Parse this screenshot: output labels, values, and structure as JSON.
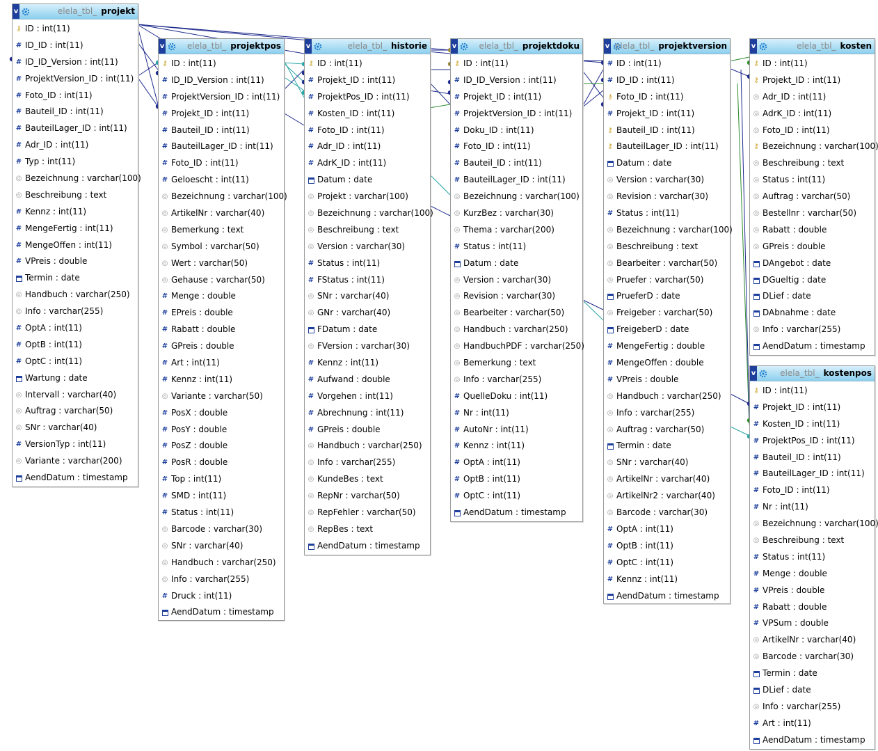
{
  "tables": [
    {
      "prefix": "elela_tbl_",
      "name": "projekt",
      "fields": [
        {
          "label": "ID : int(11)",
          "icon": "key-icon"
        },
        {
          "label": "ID_ID : int(11)",
          "icon": "number-icon"
        },
        {
          "label": "ID_ID_Version : int(11)",
          "icon": "number-icon"
        },
        {
          "label": "ProjektVersion_ID : int(11)",
          "icon": "number-icon"
        },
        {
          "label": "Foto_ID : int(11)",
          "icon": "number-icon"
        },
        {
          "label": "Bauteil_ID : int(11)",
          "icon": "number-icon"
        },
        {
          "label": "BauteilLager_ID : int(11)",
          "icon": "number-icon"
        },
        {
          "label": "Adr_ID : int(11)",
          "icon": "number-icon"
        },
        {
          "label": "Typ : int(11)",
          "icon": "number-icon"
        },
        {
          "label": "Bezeichnung : varchar(100)",
          "icon": "text-icon"
        },
        {
          "label": "Beschreibung : text",
          "icon": "text-icon"
        },
        {
          "label": "Kennz : int(11)",
          "icon": "number-icon"
        },
        {
          "label": "MengeFertig : int(11)",
          "icon": "number-icon"
        },
        {
          "label": "MengeOffen : int(11)",
          "icon": "number-icon"
        },
        {
          "label": "VPreis : double",
          "icon": "number-icon"
        },
        {
          "label": "Termin : date",
          "icon": "date-icon"
        },
        {
          "label": "Handbuch : varchar(250)",
          "icon": "text-icon"
        },
        {
          "label": "Info : varchar(255)",
          "icon": "text-icon"
        },
        {
          "label": "OptA : int(11)",
          "icon": "number-icon"
        },
        {
          "label": "OptB : int(11)",
          "icon": "number-icon"
        },
        {
          "label": "OptC : int(11)",
          "icon": "number-icon"
        },
        {
          "label": "Wartung : date",
          "icon": "date-icon"
        },
        {
          "label": "Intervall : varchar(40)",
          "icon": "text-icon"
        },
        {
          "label": "Auftrag : varchar(50)",
          "icon": "text-icon"
        },
        {
          "label": "SNr : varchar(40)",
          "icon": "text-icon"
        },
        {
          "label": "VersionTyp : int(11)",
          "icon": "number-icon"
        },
        {
          "label": "Variante : varchar(200)",
          "icon": "text-icon"
        },
        {
          "label": "AendDatum : timestamp",
          "icon": "date-icon"
        }
      ]
    },
    {
      "prefix": "elela_tbl_",
      "name": "projektpos",
      "fields": [
        {
          "label": "ID : int(11)",
          "icon": "key-icon"
        },
        {
          "label": "ID_ID_Version : int(11)",
          "icon": "number-icon"
        },
        {
          "label": "ProjektVersion_ID : int(11)",
          "icon": "number-icon"
        },
        {
          "label": "Projekt_ID : int(11)",
          "icon": "number-icon"
        },
        {
          "label": "Bauteil_ID : int(11)",
          "icon": "number-icon"
        },
        {
          "label": "BauteilLager_ID : int(11)",
          "icon": "number-icon"
        },
        {
          "label": "Foto_ID : int(11)",
          "icon": "number-icon"
        },
        {
          "label": "Geloescht : int(11)",
          "icon": "number-icon"
        },
        {
          "label": "Bezeichnung : varchar(100)",
          "icon": "text-icon"
        },
        {
          "label": "ArtikelNr : varchar(40)",
          "icon": "text-icon"
        },
        {
          "label": "Bemerkung : text",
          "icon": "text-icon"
        },
        {
          "label": "Symbol : varchar(50)",
          "icon": "text-icon"
        },
        {
          "label": "Wert : varchar(50)",
          "icon": "text-icon"
        },
        {
          "label": "Gehause : varchar(50)",
          "icon": "text-icon"
        },
        {
          "label": "Menge : double",
          "icon": "number-icon"
        },
        {
          "label": "EPreis : double",
          "icon": "number-icon"
        },
        {
          "label": "Rabatt : double",
          "icon": "number-icon"
        },
        {
          "label": "GPreis : double",
          "icon": "number-icon"
        },
        {
          "label": "Art : int(11)",
          "icon": "number-icon"
        },
        {
          "label": "Kennz : int(11)",
          "icon": "number-icon"
        },
        {
          "label": "Variante : varchar(50)",
          "icon": "text-icon"
        },
        {
          "label": "PosX : double",
          "icon": "number-icon"
        },
        {
          "label": "PosY : double",
          "icon": "number-icon"
        },
        {
          "label": "PosZ : double",
          "icon": "number-icon"
        },
        {
          "label": "PosR : double",
          "icon": "number-icon"
        },
        {
          "label": "Top : int(11)",
          "icon": "number-icon"
        },
        {
          "label": "SMD : int(11)",
          "icon": "number-icon"
        },
        {
          "label": "Status : int(11)",
          "icon": "number-icon"
        },
        {
          "label": "Barcode : varchar(30)",
          "icon": "text-icon"
        },
        {
          "label": "SNr : varchar(40)",
          "icon": "text-icon"
        },
        {
          "label": "Handbuch : varchar(250)",
          "icon": "text-icon"
        },
        {
          "label": "Info : varchar(255)",
          "icon": "text-icon"
        },
        {
          "label": "Druck : int(11)",
          "icon": "number-icon"
        },
        {
          "label": "AendDatum : timestamp",
          "icon": "date-icon"
        }
      ]
    },
    {
      "prefix": "elela_tbl_",
      "name": "historie",
      "fields": [
        {
          "label": "ID : int(11)",
          "icon": "key-icon"
        },
        {
          "label": "Projekt_ID : int(11)",
          "icon": "number-icon"
        },
        {
          "label": "ProjektPos_ID : int(11)",
          "icon": "number-icon"
        },
        {
          "label": "Kosten_ID : int(11)",
          "icon": "number-icon"
        },
        {
          "label": "Foto_ID : int(11)",
          "icon": "number-icon"
        },
        {
          "label": "Adr_ID : int(11)",
          "icon": "number-icon"
        },
        {
          "label": "AdrK_ID : int(11)",
          "icon": "number-icon"
        },
        {
          "label": "Datum : date",
          "icon": "date-icon"
        },
        {
          "label": "Projekt : varchar(100)",
          "icon": "text-icon"
        },
        {
          "label": "Bezeichnung : varchar(100)",
          "icon": "text-icon"
        },
        {
          "label": "Beschreibung : text",
          "icon": "text-icon"
        },
        {
          "label": "Version : varchar(30)",
          "icon": "text-icon"
        },
        {
          "label": "Status : int(11)",
          "icon": "number-icon"
        },
        {
          "label": "FStatus : int(11)",
          "icon": "number-icon"
        },
        {
          "label": "SNr : varchar(40)",
          "icon": "text-icon"
        },
        {
          "label": "GNr : varchar(40)",
          "icon": "text-icon"
        },
        {
          "label": "FDatum : date",
          "icon": "date-icon"
        },
        {
          "label": "FVersion : varchar(30)",
          "icon": "text-icon"
        },
        {
          "label": "Kennz : int(11)",
          "icon": "number-icon"
        },
        {
          "label": "Aufwand : double",
          "icon": "number-icon"
        },
        {
          "label": "Vorgehen : int(11)",
          "icon": "number-icon"
        },
        {
          "label": "Abrechnung : int(11)",
          "icon": "number-icon"
        },
        {
          "label": "GPreis : double",
          "icon": "number-icon"
        },
        {
          "label": "Handbuch : varchar(250)",
          "icon": "text-icon"
        },
        {
          "label": "Info : varchar(255)",
          "icon": "text-icon"
        },
        {
          "label": "KundeBes : text",
          "icon": "text-icon"
        },
        {
          "label": "RepNr : varchar(50)",
          "icon": "text-icon"
        },
        {
          "label": "RepFehler : varchar(50)",
          "icon": "text-icon"
        },
        {
          "label": "RepBes : text",
          "icon": "text-icon"
        },
        {
          "label": "AendDatum : timestamp",
          "icon": "date-icon"
        }
      ]
    },
    {
      "prefix": "elela_tbl_",
      "name": "projektdoku",
      "fields": [
        {
          "label": "ID : int(11)",
          "icon": "key-icon"
        },
        {
          "label": "ID_ID_Version : int(11)",
          "icon": "number-icon"
        },
        {
          "label": "Projekt_ID : int(11)",
          "icon": "number-icon"
        },
        {
          "label": "ProjektVersion_ID : int(11)",
          "icon": "number-icon"
        },
        {
          "label": "Doku_ID : int(11)",
          "icon": "number-icon"
        },
        {
          "label": "Foto_ID : int(11)",
          "icon": "number-icon"
        },
        {
          "label": "Bauteil_ID : int(11)",
          "icon": "number-icon"
        },
        {
          "label": "BauteilLager_ID : int(11)",
          "icon": "number-icon"
        },
        {
          "label": "Bezeichnung : varchar(100)",
          "icon": "text-icon"
        },
        {
          "label": "KurzBez : varchar(30)",
          "icon": "text-icon"
        },
        {
          "label": "Thema : varchar(200)",
          "icon": "text-icon"
        },
        {
          "label": "Status : int(11)",
          "icon": "number-icon"
        },
        {
          "label": "Datum : date",
          "icon": "date-icon"
        },
        {
          "label": "Version : varchar(30)",
          "icon": "text-icon"
        },
        {
          "label": "Revision : varchar(30)",
          "icon": "text-icon"
        },
        {
          "label": "Bearbeiter : varchar(50)",
          "icon": "text-icon"
        },
        {
          "label": "Handbuch : varchar(250)",
          "icon": "text-icon"
        },
        {
          "label": "HandbuchPDF : varchar(250)",
          "icon": "text-icon"
        },
        {
          "label": "Bemerkung : text",
          "icon": "text-icon"
        },
        {
          "label": "Info : varchar(255)",
          "icon": "text-icon"
        },
        {
          "label": "QuelleDoku : int(11)",
          "icon": "number-icon"
        },
        {
          "label": "Nr : int(11)",
          "icon": "number-icon"
        },
        {
          "label": "AutoNr : int(11)",
          "icon": "number-icon"
        },
        {
          "label": "Kennz : int(11)",
          "icon": "number-icon"
        },
        {
          "label": "OptA : int(11)",
          "icon": "number-icon"
        },
        {
          "label": "OptB : int(11)",
          "icon": "number-icon"
        },
        {
          "label": "OptC : int(11)",
          "icon": "number-icon"
        },
        {
          "label": "AendDatum : timestamp",
          "icon": "date-icon"
        }
      ]
    },
    {
      "prefix": "elela_tbl_",
      "name": "projektversion",
      "fields": [
        {
          "label": "ID : int(11)",
          "icon": "number-icon"
        },
        {
          "label": "ID_ID : int(11)",
          "icon": "number-icon"
        },
        {
          "label": "Foto_ID : int(11)",
          "icon": "key-icon"
        },
        {
          "label": "Projekt_ID : int(11)",
          "icon": "number-icon"
        },
        {
          "label": "Bauteil_ID : int(11)",
          "icon": "key-icon"
        },
        {
          "label": "BauteilLager_ID : int(11)",
          "icon": "key-icon"
        },
        {
          "label": "Datum : date",
          "icon": "date-icon"
        },
        {
          "label": "Version : varchar(30)",
          "icon": "text-icon"
        },
        {
          "label": "Revision : varchar(30)",
          "icon": "text-icon"
        },
        {
          "label": "Status : int(11)",
          "icon": "number-icon"
        },
        {
          "label": "Bezeichnung : varchar(100)",
          "icon": "text-icon"
        },
        {
          "label": "Beschreibung : text",
          "icon": "text-icon"
        },
        {
          "label": "Bearbeiter : varchar(50)",
          "icon": "text-icon"
        },
        {
          "label": "Pruefer : varchar(50)",
          "icon": "text-icon"
        },
        {
          "label": "PrueferD : date",
          "icon": "date-icon"
        },
        {
          "label": "Freigeber : varchar(50)",
          "icon": "text-icon"
        },
        {
          "label": "FreigeberD : date",
          "icon": "date-icon"
        },
        {
          "label": "MengeFertig : double",
          "icon": "number-icon"
        },
        {
          "label": "MengeOffen : double",
          "icon": "number-icon"
        },
        {
          "label": "VPreis : double",
          "icon": "number-icon"
        },
        {
          "label": "Handbuch : varchar(250)",
          "icon": "text-icon"
        },
        {
          "label": "Info : varchar(255)",
          "icon": "text-icon"
        },
        {
          "label": "Auftrag : varchar(50)",
          "icon": "text-icon"
        },
        {
          "label": "Termin : date",
          "icon": "date-icon"
        },
        {
          "label": "SNr : varchar(40)",
          "icon": "text-icon"
        },
        {
          "label": "ArtikelNr : varchar(40)",
          "icon": "text-icon"
        },
        {
          "label": "ArtikelNr2 : varchar(40)",
          "icon": "text-icon"
        },
        {
          "label": "Barcode : varchar(30)",
          "icon": "text-icon"
        },
        {
          "label": "OptA : int(11)",
          "icon": "number-icon"
        },
        {
          "label": "OptB : int(11)",
          "icon": "number-icon"
        },
        {
          "label": "OptC : int(11)",
          "icon": "number-icon"
        },
        {
          "label": "Kennz : int(11)",
          "icon": "number-icon"
        },
        {
          "label": "AendDatum : timestamp",
          "icon": "date-icon"
        }
      ]
    },
    {
      "prefix": "elela_tbl_",
      "name": "kosten",
      "fields": [
        {
          "label": "ID : int(11)",
          "icon": "key-icon"
        },
        {
          "label": "Projekt_ID : int(11)",
          "icon": "key-icon"
        },
        {
          "label": "Adr_ID : int(11)",
          "icon": "text-icon"
        },
        {
          "label": "AdrK_ID : int(11)",
          "icon": "text-icon"
        },
        {
          "label": "Foto_ID : int(11)",
          "icon": "text-icon"
        },
        {
          "label": "Bezeichnung : varchar(100)",
          "icon": "key-icon"
        },
        {
          "label": "Beschreibung : text",
          "icon": "text-icon"
        },
        {
          "label": "Status : int(11)",
          "icon": "text-icon"
        },
        {
          "label": "Auftrag : varchar(50)",
          "icon": "text-icon"
        },
        {
          "label": "Bestellnr : varchar(50)",
          "icon": "text-icon"
        },
        {
          "label": "Rabatt : double",
          "icon": "text-icon"
        },
        {
          "label": "GPreis : double",
          "icon": "text-icon"
        },
        {
          "label": "DAngebot : date",
          "icon": "date-icon"
        },
        {
          "label": "DGueltig : date",
          "icon": "date-icon"
        },
        {
          "label": "DLief : date",
          "icon": "date-icon"
        },
        {
          "label": "DAbnahme : date",
          "icon": "date-icon"
        },
        {
          "label": "Info : varchar(255)",
          "icon": "text-icon"
        },
        {
          "label": "AendDatum : timestamp",
          "icon": "date-icon"
        }
      ]
    },
    {
      "prefix": "elela_tbl_",
      "name": "kostenpos",
      "fields": [
        {
          "label": "ID : int(11)",
          "icon": "key-icon"
        },
        {
          "label": "Projekt_ID : int(11)",
          "icon": "number-icon"
        },
        {
          "label": "Kosten_ID : int(11)",
          "icon": "number-icon"
        },
        {
          "label": "ProjektPos_ID : int(11)",
          "icon": "number-icon"
        },
        {
          "label": "Bauteil_ID : int(11)",
          "icon": "number-icon"
        },
        {
          "label": "BauteilLager_ID : int(11)",
          "icon": "number-icon"
        },
        {
          "label": "Foto_ID : int(11)",
          "icon": "number-icon"
        },
        {
          "label": "Nr : int(11)",
          "icon": "number-icon"
        },
        {
          "label": "Bezeichnung : varchar(100)",
          "icon": "text-icon"
        },
        {
          "label": "Beschreibung : text",
          "icon": "text-icon"
        },
        {
          "label": "Status : int(11)",
          "icon": "number-icon"
        },
        {
          "label": "Menge : double",
          "icon": "number-icon"
        },
        {
          "label": "VPreis : double",
          "icon": "number-icon"
        },
        {
          "label": "Rabatt : double",
          "icon": "number-icon"
        },
        {
          "label": "VPSum : double",
          "icon": "number-icon"
        },
        {
          "label": "ArtikelNr : varchar(40)",
          "icon": "text-icon"
        },
        {
          "label": "Barcode : varchar(30)",
          "icon": "text-icon"
        },
        {
          "label": "Termin : date",
          "icon": "date-icon"
        },
        {
          "label": "DLief : date",
          "icon": "date-icon"
        },
        {
          "label": "Info : varchar(255)",
          "icon": "text-icon"
        },
        {
          "label": "Art : int(11)",
          "icon": "number-icon"
        },
        {
          "label": "AendDatum : timestamp",
          "icon": "date-icon"
        }
      ]
    }
  ],
  "colors": {
    "relation_navy": "#1e2a8c",
    "relation_teal": "#2aa6a6",
    "relation_green": "#2e8b2e",
    "relation_olive": "#9a8a3a",
    "header_gradient_top": "#d7f0fb",
    "header_gradient_bottom": "#8ccfee"
  }
}
